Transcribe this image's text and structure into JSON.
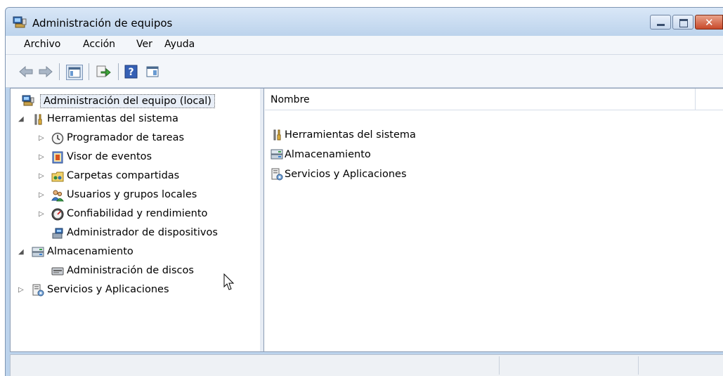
{
  "window": {
    "title": "Administración de equipos",
    "accent": "#bcd3ec"
  },
  "menu": [
    "Archivo",
    "Acción",
    "Ver",
    "Ayuda"
  ],
  "toolbar": {
    "icons": [
      "back-arrow-icon",
      "forward-arrow-icon",
      "show-hide-tree-icon",
      "export-list-icon",
      "help-icon",
      "show-hide-action-pane-icon"
    ]
  },
  "tree": {
    "root": "Administración del equipo (local)",
    "tools": "Herramientas del sistema",
    "task_scheduler": "Programador de tareas",
    "event_viewer": "Visor de eventos",
    "shared_folders": "Carpetas compartidas",
    "local_users": "Usuarios y grupos locales",
    "reliability": "Confiabilidad y rendimiento",
    "device_manager": "Administrador de dispositivos",
    "storage": "Almacenamiento",
    "disk_management": "Administración de discos",
    "services": "Servicios y Aplicaciones"
  },
  "list": {
    "column": "Nombre",
    "items": [
      "Herramientas del sistema",
      "Almacenamiento",
      "Servicios y Aplicaciones"
    ]
  }
}
